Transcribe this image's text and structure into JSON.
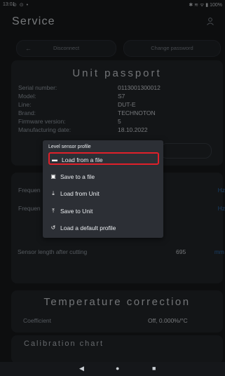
{
  "statusbar": {
    "time": "13:01",
    "left_icons": "⊙ ⊙ •",
    "right": "✱ ≋ ᯤ ▮ 100%"
  },
  "header": {
    "title": "Service"
  },
  "buttons": {
    "back": "←",
    "disconnect": "Disconnect",
    "change_password": "Change password"
  },
  "passport": {
    "title": "Unit passport",
    "rows": [
      {
        "label": "Serial number:",
        "value": "0113001300012"
      },
      {
        "label": "Model:",
        "value": "S7"
      },
      {
        "label": "Line:",
        "value": "DUT-E"
      },
      {
        "label": "Brand:",
        "value": "TECHNOTON"
      },
      {
        "label": "Firmware version:",
        "value": "5"
      },
      {
        "label": "Manufacturing date:",
        "value": "18.10.2022"
      }
    ]
  },
  "sensor": {
    "rows": [
      {
        "label": "Frequen",
        "unit": "Hz"
      },
      {
        "label": "Frequen",
        "unit": "Hz"
      },
      {
        "label": "Sensor length after cutting",
        "value": "695",
        "unit": "mm"
      }
    ]
  },
  "temperature": {
    "title": "Temperature correction",
    "coef_label": "Coefficient",
    "coef_value": "Off, 0.000%/°C"
  },
  "calibration": {
    "title": "Calibration chart"
  },
  "menu": {
    "title": "Level sensor profile",
    "items": [
      {
        "label": "Load from a file",
        "icon": "folder-icon",
        "glyph": "▬"
      },
      {
        "label": "Save to a file",
        "icon": "save-icon",
        "glyph": "▣"
      },
      {
        "label": "Load from Unit",
        "icon": "download-icon",
        "glyph": "⤓"
      },
      {
        "label": "Save to Unit",
        "icon": "upload-icon",
        "glyph": "⤒"
      },
      {
        "label": "Load a default profile",
        "icon": "reset-icon",
        "glyph": "↺"
      }
    ]
  },
  "navbar": {
    "back": "◀",
    "home": "●",
    "recents": "■"
  },
  "colors": {
    "highlight": "#e0202a",
    "accent": "#2f6fb3",
    "background": "#181a1d"
  }
}
